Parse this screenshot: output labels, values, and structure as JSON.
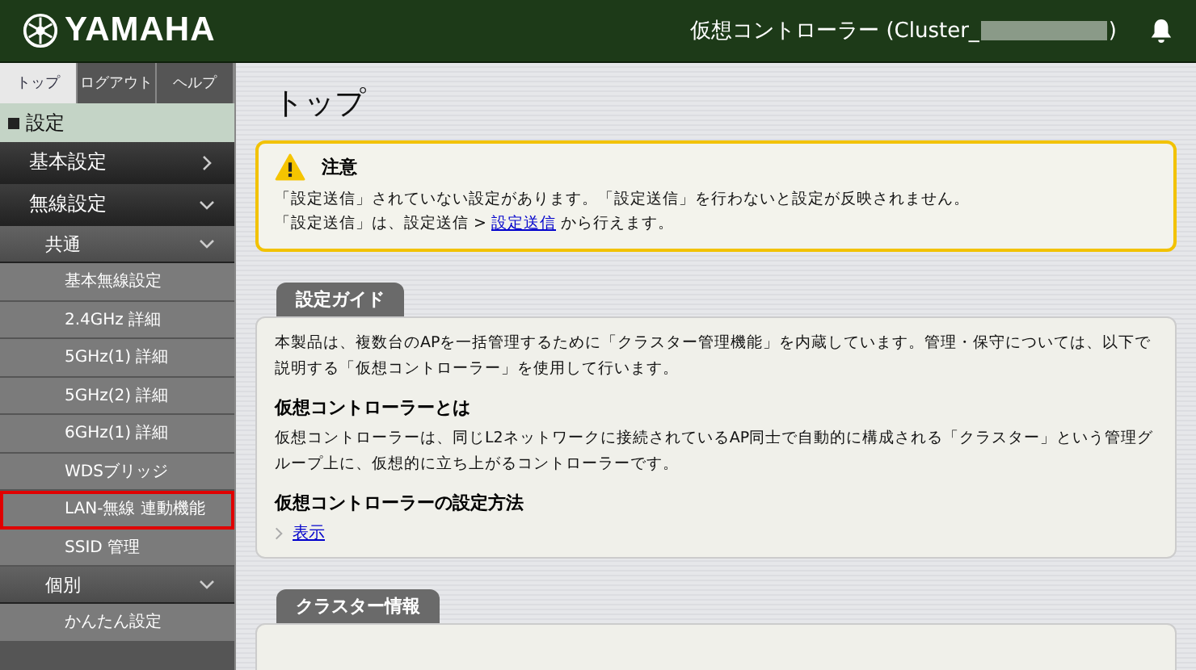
{
  "header": {
    "logo": "YAMAHA",
    "title_prefix": "仮想コントローラー (Cluster_",
    "title_suffix": ")"
  },
  "sidebar": {
    "tabs": [
      {
        "label": "トップ",
        "selected": true
      },
      {
        "label": "ログアウト",
        "selected": false
      },
      {
        "label": "ヘルプ",
        "selected": false
      }
    ],
    "section": "設定",
    "items": [
      {
        "label": "基本設定",
        "expanded": false
      },
      {
        "label": "無線設定",
        "expanded": true,
        "children": [
          {
            "label": "共通",
            "expanded": true,
            "children": [
              {
                "label": "基本無線設定",
                "outlined": false
              },
              {
                "label": "2.4GHz 詳細",
                "outlined": false
              },
              {
                "label": "5GHz(1) 詳細",
                "outlined": false
              },
              {
                "label": "5GHz(2) 詳細",
                "outlined": false
              },
              {
                "label": "6GHz(1) 詳細",
                "outlined": false
              },
              {
                "label": "WDSブリッジ",
                "outlined": false
              },
              {
                "label": "LAN-無線 連動機能",
                "outlined": true
              },
              {
                "label": "SSID 管理",
                "outlined": false
              }
            ]
          },
          {
            "label": "個別",
            "expanded": true,
            "children": [
              {
                "label": "かんたん設定",
                "outlined": false
              }
            ]
          }
        ]
      }
    ]
  },
  "main": {
    "title": "トップ",
    "notice": {
      "title": "注意",
      "lines": [
        "「設定送信」されていない設定があります。「設定送信」を行わないと設定が反映されません。"
      ],
      "link_line": {
        "before": "「設定送信」は、設定送信 > ",
        "link": "設定送信",
        "after": " から行えます。"
      }
    },
    "panels": [
      {
        "title": "設定ガイド",
        "blocks": [
          {
            "kind": "text",
            "text": "本製品は、複数台のAPを一括管理するために「クラスター管理機能」を内蔵しています。管理・保守については、以下で説明する「仮想コントローラー」を使用して行います。"
          },
          {
            "kind": "heading",
            "text": "仮想コントローラーとは"
          },
          {
            "kind": "text",
            "text": "仮想コントローラーは、同じL2ネットワークに接続されているAP同士で自動的に構成される「クラスター」という管理グループ上に、仮想的に立ち上がるコントローラーです。"
          },
          {
            "kind": "heading",
            "text": "仮想コントローラーの設定方法"
          },
          {
            "kind": "link",
            "text": "表示"
          }
        ]
      },
      {
        "title": "クラスター情報"
      }
    ]
  }
}
